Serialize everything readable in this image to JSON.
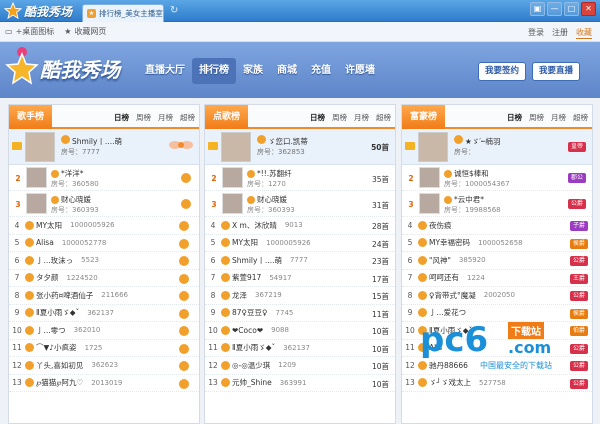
{
  "window": {
    "app_title": "酷我秀场",
    "tab_label": "排行榜_美女主播室",
    "controls": [
      "▣",
      "—",
      "□",
      "✕"
    ]
  },
  "toolbar": {
    "desktop_icon": "+桌面图标",
    "bookmark": "收藏网页",
    "login": "登录",
    "register": "注册",
    "favorite": "收藏"
  },
  "banner": {
    "logo_text": "酷我秀场",
    "nav": [
      "直播大厅",
      "排行榜",
      "家族",
      "商城",
      "充值",
      "许愿墙"
    ],
    "active_nav": "排行榜",
    "sign_button": "我要签约",
    "live_button": "我要直播"
  },
  "period_tabs": [
    "日榜",
    "周榜",
    "月榜",
    "超榜"
  ],
  "room_prefix": "房号：",
  "colors": {
    "accent": "#f07c18",
    "banner": "#6a92d4",
    "highlight": "#e9f1fb"
  },
  "panels": [
    {
      "title": "歌手榜",
      "top": {
        "rank": "1",
        "name": "Shmily丨....萌",
        "room": "7777"
      },
      "second": [
        {
          "rank": "2",
          "name": "*洋洋*",
          "room": "360580"
        },
        {
          "rank": "3",
          "name": "财心晓媛",
          "room": "360393"
        }
      ],
      "rows": [
        {
          "rank": "4",
          "name": "MY太阳",
          "room": "1000005926"
        },
        {
          "rank": "5",
          "name": "Alisa",
          "room": "1000052778"
        },
        {
          "rank": "6",
          "name": "亅...玫沫っ",
          "room": "5523"
        },
        {
          "rank": "7",
          "name": "タ夕颜",
          "room": "1224520"
        },
        {
          "rank": "8",
          "name": "张小药¤啤酒仙子",
          "room": "211666"
        },
        {
          "rank": "9",
          "name": "Ⅱ夏小雨ゞ◆ˇ",
          "room": "362137"
        },
        {
          "rank": "10",
          "name": "亅...零つ",
          "room": "362010"
        },
        {
          "rank": "11",
          "name": "⌒▼♪小疯姿",
          "room": "1725"
        },
        {
          "rank": "12",
          "name": "丫头,喜如初见",
          "room": "362623"
        },
        {
          "rank": "13",
          "name": "℘猫猫℘阿九♡",
          "room": "2013019"
        }
      ]
    },
    {
      "title": "点歌榜",
      "top": {
        "rank": "1",
        "name": "ゞ您口.凯蒂",
        "room": "362853",
        "count": "50首"
      },
      "second": [
        {
          "rank": "2",
          "name": "*!!.苏翻纤",
          "room": "1270",
          "count": "35首"
        },
        {
          "rank": "3",
          "name": "财心晓媛",
          "room": "360393",
          "count": "31首"
        }
      ],
      "rows": [
        {
          "rank": "4",
          "name": "X m、沐欣晴",
          "room": "9013",
          "count": "28首"
        },
        {
          "rank": "5",
          "name": "MY太阳",
          "room": "1000005926",
          "count": "24首"
        },
        {
          "rank": "6",
          "name": "Shmily丨....萌",
          "room": "7777",
          "count": "23首"
        },
        {
          "rank": "7",
          "name": "紫萱917",
          "room": "54917",
          "count": "17首"
        },
        {
          "rank": "8",
          "name": "龙泽",
          "room": "367219",
          "count": "15首"
        },
        {
          "rank": "9",
          "name": "87♀豆豆♀",
          "room": "7745",
          "count": "11首"
        },
        {
          "rank": "10",
          "name": "❤Coco❤",
          "room": "9088",
          "count": "10首"
        },
        {
          "rank": "11",
          "name": "Ⅱ夏小雨ゞ◆ˇ",
          "room": "362137",
          "count": "10首"
        },
        {
          "rank": "12",
          "name": "◎-◎温少琪",
          "room": "1209",
          "count": "10首"
        },
        {
          "rank": "13",
          "name": "元帅_Shine",
          "room": "363991",
          "count": "10首"
        }
      ]
    },
    {
      "title": "富豪榜",
      "top": {
        "rank": "1",
        "name": "★ゞ′┉楠羽",
        "room": "",
        "badge": "皇帝"
      },
      "second": [
        {
          "rank": "2",
          "name": "诚恒$棒和",
          "room": "1000054367",
          "badge": "郡公"
        },
        {
          "rank": "3",
          "name": "*云中君*",
          "room": "19988568",
          "badge": "公爵"
        }
      ],
      "rows": [
        {
          "rank": "4",
          "name": "夜伤痕",
          "room": "",
          "badge": "子爵"
        },
        {
          "rank": "5",
          "name": "MY幸福密码",
          "room": "1000052658",
          "badge": "侯爵"
        },
        {
          "rank": "6",
          "name": "\"风神\"",
          "room": "385920",
          "badge": "公爵"
        },
        {
          "rank": "7",
          "name": "呵呵还有",
          "room": "1224",
          "badge": "王爵"
        },
        {
          "rank": "8",
          "name": "♀背带式°魔凝",
          "room": "2002050",
          "badge": "公爵"
        },
        {
          "rank": "9",
          "name": "亅...爱花つ",
          "room": "",
          "badge": "侯爵"
        },
        {
          "rank": "10",
          "name": "Ⅱ夏小雨ゞ◆ˇ",
          "room": "",
          "badge": "伯爵"
        },
        {
          "rank": "11",
          "name": "Alis",
          "room": "",
          "badge": "公爵"
        },
        {
          "rank": "12",
          "name": "驰丹88666",
          "room": "",
          "badge": "公爵"
        },
        {
          "rank": "13",
          "name": "ゞ┘ゞ戏太上",
          "room": "527758",
          "badge": "公爵"
        }
      ]
    }
  ],
  "watermark": {
    "logo": "pc6",
    "download": "下载站",
    "domain": ".com",
    "slogan": "中国最安全的下载站"
  }
}
